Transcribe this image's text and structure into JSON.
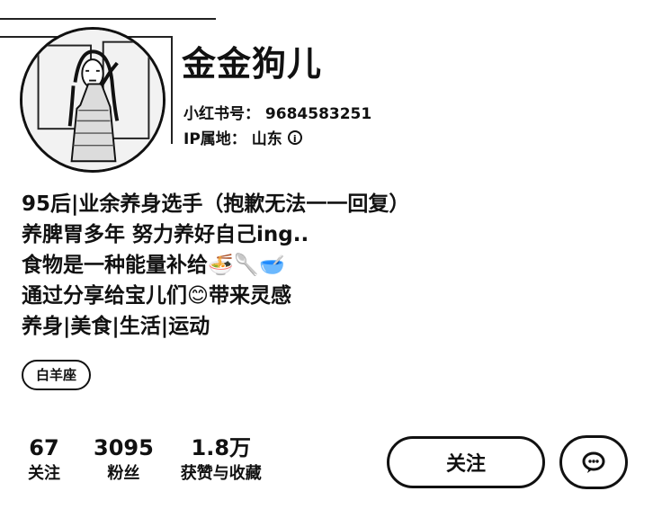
{
  "profile": {
    "name": "金金狗儿",
    "id_label": "小红书号：",
    "id_value": "9684583251",
    "ip_label": "IP属地：",
    "ip_value": "山东",
    "info_icon": "info-icon",
    "avatar_icon": "avatar-image"
  },
  "bio": {
    "lines": [
      "95后|业余养身选手（抱歉无法一一回复）",
      "养脾胃多年 努力养好自己ing..",
      "食物是一种能量补给🍜🥄🥣",
      "通过分享给宝儿们😊带来灵感",
      "养身|美食|生活|运动"
    ]
  },
  "tags": {
    "zodiac": "白羊座"
  },
  "stats": [
    {
      "value": "67",
      "label": "关注"
    },
    {
      "value": "3095",
      "label": "粉丝"
    },
    {
      "value": "1.8万",
      "label": "获赞与收藏"
    }
  ],
  "actions": {
    "follow_label": "关注",
    "message_icon": "chat-bubble-icon"
  }
}
